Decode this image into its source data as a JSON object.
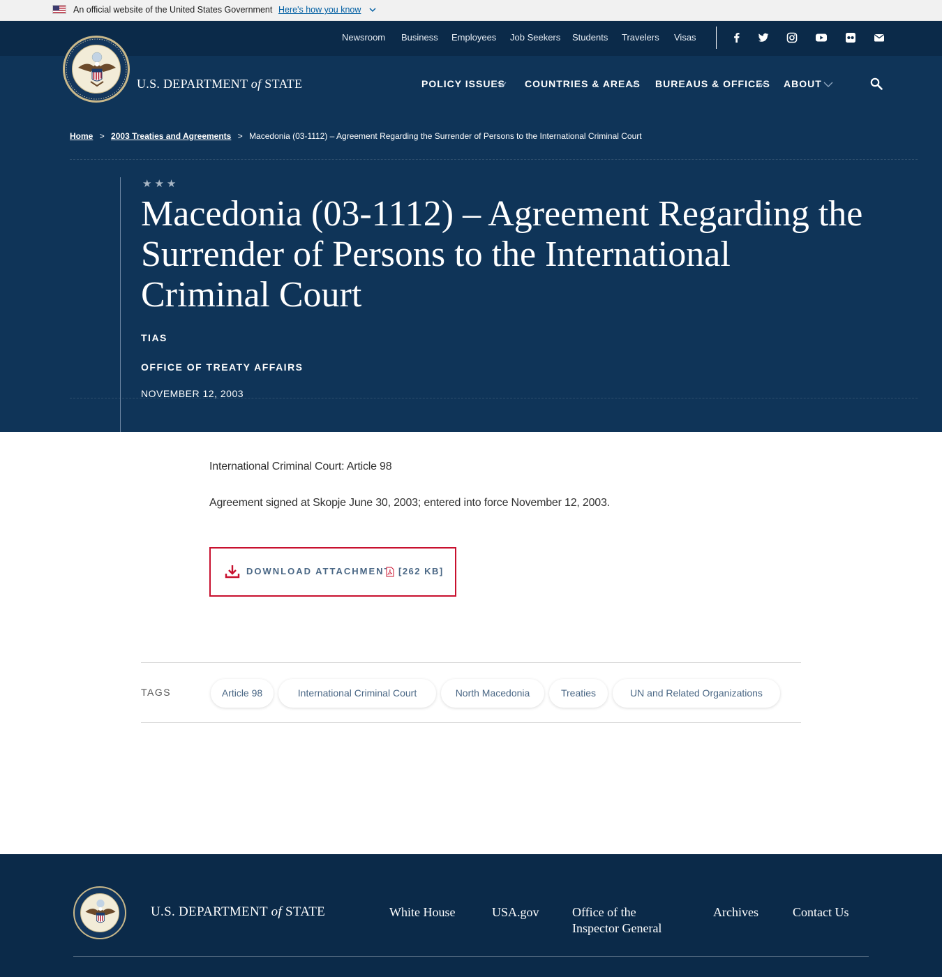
{
  "gov_banner": {
    "text": "An official website of the United States Government",
    "link": "Here's how you know"
  },
  "utility_nav": [
    "Newsroom",
    "Business",
    "Employees",
    "Job Seekers",
    "Students",
    "Travelers",
    "Visas"
  ],
  "social_icons": [
    "facebook-icon",
    "twitter-icon",
    "instagram-icon",
    "youtube-icon",
    "flickr-icon",
    "email-icon"
  ],
  "brand": {
    "pre": "U.S. DEPARTMENT",
    "of": "of",
    "post": "STATE"
  },
  "main_nav": [
    "POLICY ISSUES",
    "COUNTRIES & AREAS",
    "BUREAUS & OFFICES",
    "ABOUT"
  ],
  "breadcrumb": {
    "home": "Home",
    "parent": "2003 Treaties and Agreements",
    "sep": ">",
    "current": "Macedonia (03-1112) – Agreement Regarding the Surrender of Persons to the International Criminal Court"
  },
  "hero": {
    "stars": "★★★",
    "title": "Macedonia (03-1112) – Agreement Regarding the Surrender of Persons to the International Criminal Court",
    "tag": "TIAS",
    "office": "OFFICE OF TREATY AFFAIRS",
    "date": "NOVEMBER 12, 2003"
  },
  "content": {
    "p1": "International Criminal Court: Article 98",
    "p2": "Agreement signed at Skopje June 30, 2003; entered into force November 12, 2003."
  },
  "download": {
    "label": "DOWNLOAD ATTACHMENT",
    "size": "[262 KB]"
  },
  "tags": {
    "label": "TAGS",
    "items": [
      "Article 98",
      "International Criminal Court",
      "North Macedonia",
      "Treaties",
      "UN and Related Organizations"
    ]
  },
  "footer": {
    "links": [
      "White House",
      "USA.gov",
      "Office of the Inspector General",
      "Archives",
      "Contact Us"
    ]
  },
  "colors": {
    "header_bg": "#0f3458",
    "topbar_bg": "#0b2a49",
    "accent_red": "#c8102e",
    "link_blue": "#4a6785",
    "seal_gold": "#c9b88a"
  }
}
